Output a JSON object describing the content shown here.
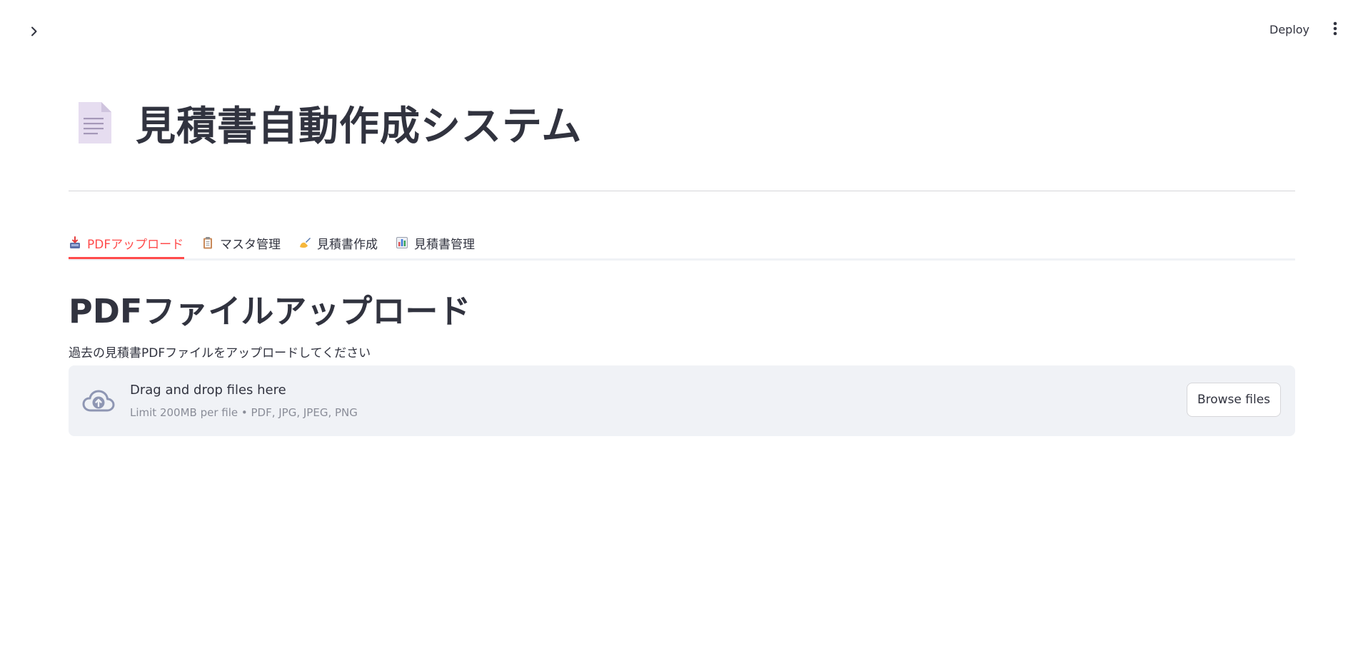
{
  "header": {
    "deploy_label": "Deploy",
    "sidebar_toggle_icon": "chevron-right-icon",
    "menu_icon": "vertical-ellipsis-icon"
  },
  "title": {
    "emoji": "page-facing-up-icon",
    "text": "見積書自動作成システム"
  },
  "tabs": [
    {
      "label": "PDFアップロード",
      "icon": "inbox-tray-icon",
      "active": true
    },
    {
      "label": "マスタ管理",
      "icon": "clipboard-icon",
      "active": false
    },
    {
      "label": "見積書作成",
      "icon": "writing-hand-icon",
      "active": false
    },
    {
      "label": "見積書管理",
      "icon": "bar-chart-icon",
      "active": false
    }
  ],
  "section": {
    "title": "PDFファイルアップロード",
    "caption": "過去の見積書PDFファイルをアップロードしてください"
  },
  "uploader": {
    "icon": "cloud-upload-icon",
    "drop_text": "Drag and drop files here",
    "limit_text": "Limit 200MB per file • PDF, JPG, JPEG, PNG",
    "browse_label": "Browse files"
  },
  "colors": {
    "accent": "#ff4b4b",
    "text": "#31333f",
    "uploader_bg": "#f0f2f6"
  }
}
